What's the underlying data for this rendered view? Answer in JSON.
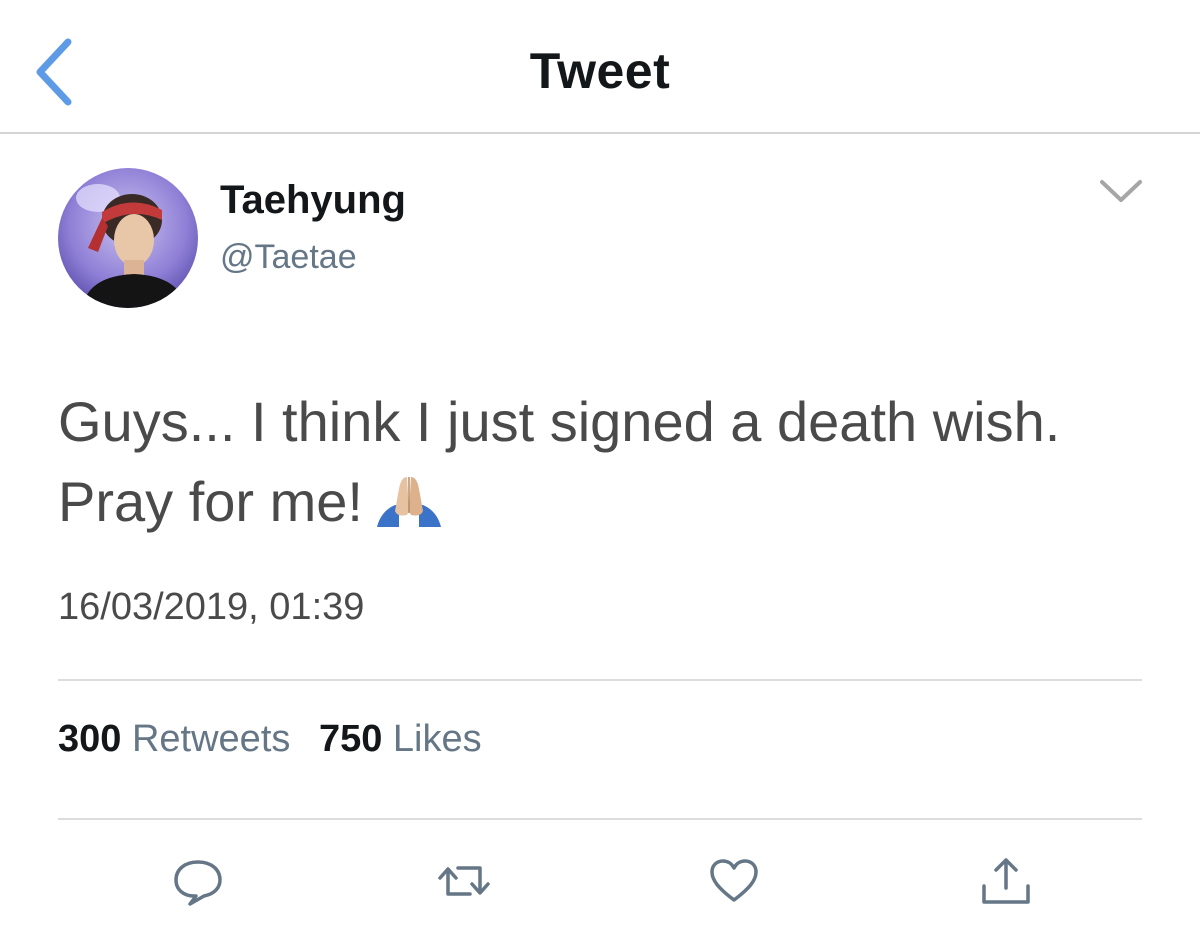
{
  "nav": {
    "title": "Tweet",
    "back_icon": "chevron-left-icon"
  },
  "tweet": {
    "author": {
      "display_name": "Taehyung",
      "handle": "@Taetae"
    },
    "text_line1": "Guys... I think I just signed a death wish.",
    "text_line2": "Pray for me!",
    "emoji": "folded-hands-emoji",
    "timestamp": "16/03/2019, 01:39",
    "stats": {
      "retweets_count": "300",
      "retweets_label": "Retweets",
      "likes_count": "750",
      "likes_label": "Likes"
    }
  },
  "actions": {
    "icons": [
      "reply-icon",
      "retweet-icon",
      "like-icon",
      "share-icon"
    ]
  },
  "colors": {
    "accent": "#4a90e2",
    "text_dark": "#14171a",
    "text_body": "#4a4a4a",
    "text_muted": "#657786",
    "icon_gray": "#657786",
    "divider": "#dcdcdc"
  }
}
